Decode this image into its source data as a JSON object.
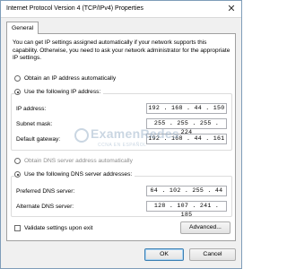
{
  "window": {
    "title": "Internet Protocol Version 4 (TCP/IPv4) Properties",
    "close_glyph": "✕"
  },
  "tab": {
    "label": "General"
  },
  "description": "You can get IP settings assigned automatically if your network supports this capability. Otherwise, you need to ask your network administrator for the appropriate IP settings.",
  "ip_mode": {
    "auto_label": "Obtain an IP address automatically",
    "manual_label": "Use the following IP address:",
    "selected": "manual"
  },
  "ip_fields": {
    "ip_address": {
      "label": "IP address:",
      "value": "192 . 168 . 44 . 150"
    },
    "subnet_mask": {
      "label": "Subnet mask:",
      "value": "255 . 255 . 255 . 224"
    },
    "default_gateway": {
      "label": "Default gateway:",
      "value": "192 . 168 . 44 . 161"
    }
  },
  "dns_mode": {
    "auto_label": "Obtain DNS server address automatically",
    "manual_label": "Use the following DNS server addresses:",
    "selected": "manual"
  },
  "dns_fields": {
    "preferred": {
      "label": "Preferred DNS server:",
      "value": "64 . 102 . 255 . 44"
    },
    "alternate": {
      "label": "Alternate DNS server:",
      "value": "128 . 107 . 241 . 185"
    }
  },
  "validate": {
    "label": "Validate settings upon exit",
    "checked": false
  },
  "buttons": {
    "advanced": "Advanced...",
    "ok": "OK",
    "cancel": "Cancel"
  },
  "watermark": {
    "main": "ExamenRedes",
    "sub": "CCNA EN ESPAÑOL"
  }
}
